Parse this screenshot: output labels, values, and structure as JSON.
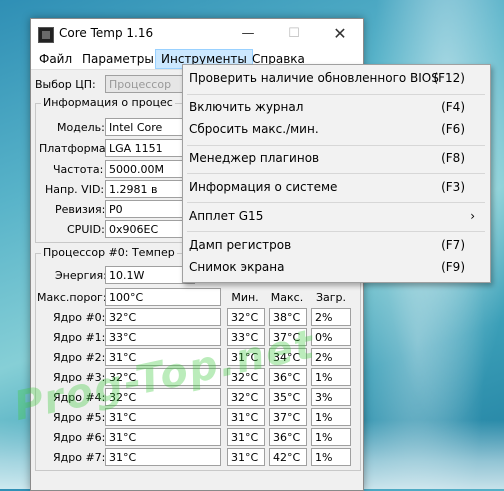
{
  "window": {
    "title": "Core Temp 1.16"
  },
  "menu": {
    "file": "Файл",
    "params": "Параметры",
    "tools": "Инструменты",
    "help": "Справка"
  },
  "cpu_select": {
    "label": "Выбор ЦП:",
    "value": "Процессор"
  },
  "info": {
    "title": "Информация о процес",
    "model_label": "Модель:",
    "model_value": "Intel Core",
    "platform_label": "Платформа:",
    "platform_value": "LGA 1151",
    "freq_label": "Частота:",
    "freq_value": "5000.00M",
    "vid_label": "Напр. VID:",
    "vid_value": "1.2981 в",
    "rev_label": "Ревизия:",
    "rev_value": "P0",
    "cpuid_label": "CPUID:",
    "cpuid_value": "0x906EC"
  },
  "temps": {
    "title": "Процессор #0: Темпер",
    "power_label": "Энергия:",
    "power_value": "10.1W",
    "tjmax_label": "Макс.порог:",
    "tjmax_value": "100°C",
    "col_min": "Мин.",
    "col_max": "Макс.",
    "col_load": "Загр.",
    "cores": [
      {
        "label": "Ядро #0:",
        "temp": "32°C",
        "min": "32°C",
        "max": "38°C",
        "load": "2%"
      },
      {
        "label": "Ядро #1:",
        "temp": "33°C",
        "min": "33°C",
        "max": "37°C",
        "load": "0%"
      },
      {
        "label": "Ядро #2:",
        "temp": "31°C",
        "min": "31°C",
        "max": "34°C",
        "load": "2%"
      },
      {
        "label": "Ядро #3:",
        "temp": "32°C",
        "min": "32°C",
        "max": "36°C",
        "load": "1%"
      },
      {
        "label": "Ядро #4:",
        "temp": "32°C",
        "min": "32°C",
        "max": "35°C",
        "load": "3%"
      },
      {
        "label": "Ядро #5:",
        "temp": "31°C",
        "min": "31°C",
        "max": "37°C",
        "load": "1%"
      },
      {
        "label": "Ядро #6:",
        "temp": "31°C",
        "min": "31°C",
        "max": "36°C",
        "load": "1%"
      },
      {
        "label": "Ядро #7:",
        "temp": "31°C",
        "min": "31°C",
        "max": "42°C",
        "load": "1%"
      }
    ]
  },
  "dropdown": {
    "items": [
      {
        "label": "Проверить наличие обновленного BIOS",
        "key": "(F12)"
      },
      {
        "label": "Включить журнал",
        "key": "(F4)"
      },
      {
        "label": "Сбросить макс./мин.",
        "key": "(F6)"
      },
      {
        "label": "Менеджер плагинов",
        "key": "(F8)"
      },
      {
        "label": "Информация о системе",
        "key": "(F3)"
      },
      {
        "label": "Апплет G15",
        "key": ""
      },
      {
        "label": "Дамп регистров",
        "key": "(F7)"
      },
      {
        "label": "Снимок экрана",
        "key": "(F9)"
      }
    ],
    "submenu_arrow": "›"
  },
  "watermark": "Prog-Top.net"
}
